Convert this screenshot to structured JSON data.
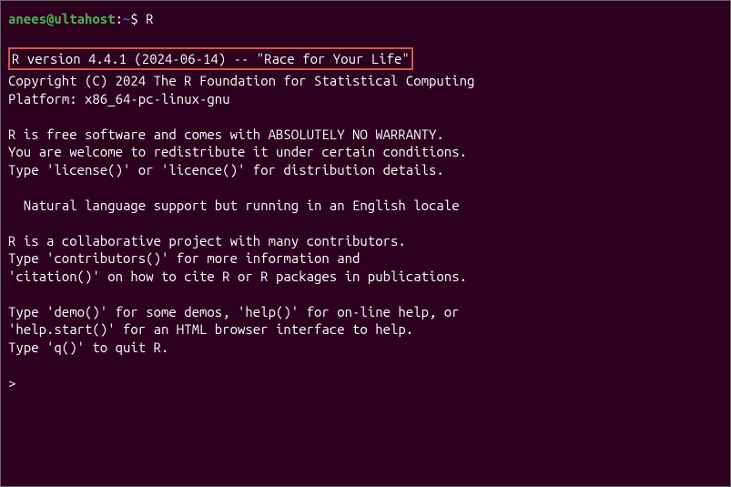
{
  "prompt": {
    "user_host": "anees@ultahost",
    "colon": ":",
    "path": "~",
    "dollar": "$ ",
    "command": "R"
  },
  "output": {
    "version_line": "R version 4.4.1 (2024-06-14) -- \"Race for Your Life\"",
    "copyright": "Copyright (C) 2024 The R Foundation for Statistical Computing",
    "platform": "Platform: x86_64-pc-linux-gnu",
    "free1": "R is free software and comes with ABSOLUTELY NO WARRANTY.",
    "free2": "You are welcome to redistribute it under certain conditions.",
    "free3": "Type 'license()' or 'licence()' for distribution details.",
    "natlang": "  Natural language support but running in an English locale",
    "collab1": "R is a collaborative project with many contributors.",
    "collab2": "Type 'contributors()' for more information and",
    "collab3": "'citation()' on how to cite R or R packages in publications.",
    "help1": "Type 'demo()' for some demos, 'help()' for on-line help, or",
    "help2": "'help.start()' for an HTML browser interface to help.",
    "help3": "Type 'q()' to quit R.",
    "r_prompt": "> "
  }
}
